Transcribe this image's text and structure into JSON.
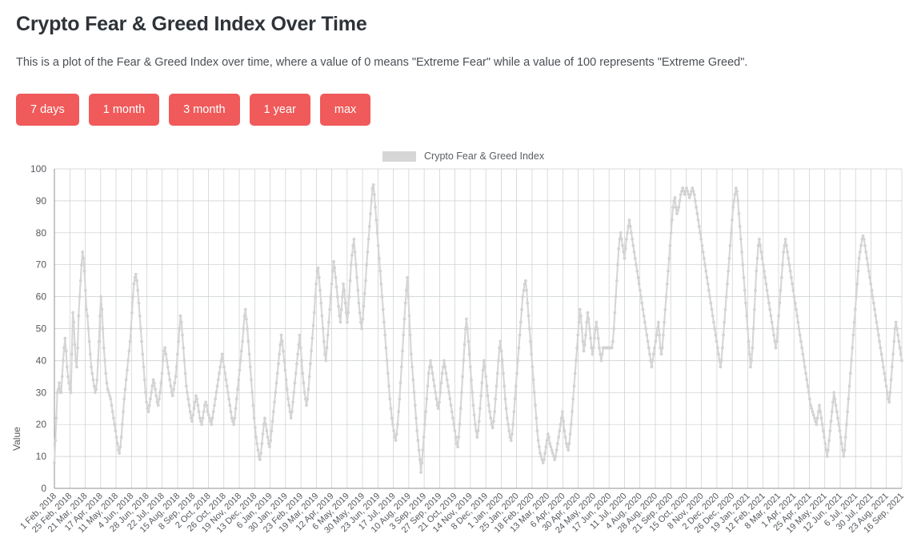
{
  "header": {
    "title": "Crypto Fear & Greed Index Over Time",
    "description": "This is a plot of the Fear & Greed Index over time, where a value of 0 means \"Extreme Fear\" while a value of 100 represents \"Extreme Greed\"."
  },
  "range_buttons": [
    {
      "label": "7 days"
    },
    {
      "label": "1 month"
    },
    {
      "label": "3 month"
    },
    {
      "label": "1 year"
    },
    {
      "label": "max"
    }
  ],
  "colors": {
    "button": "#f05a5a",
    "button_text": "#ffffff",
    "series": "#d3d3d3",
    "grid": "#c9cdd1",
    "axis": "#8c9195",
    "text": "#55595e",
    "title": "#2e3338"
  },
  "chart_data": {
    "type": "line",
    "title": "",
    "xlabel": "",
    "ylabel": "Value",
    "ylim": [
      0,
      100
    ],
    "ytick_step": 10,
    "yticks": [
      0,
      10,
      20,
      30,
      40,
      50,
      60,
      70,
      80,
      90,
      100
    ],
    "grid": true,
    "legend_position": "top-center",
    "legend": [
      "Crypto Fear & Greed Index"
    ],
    "series": [
      {
        "name": "Crypto Fear & Greed Index",
        "color": "#d3d3d3",
        "marker": "circle",
        "values": [
          8,
          15,
          22,
          30,
          31,
          33,
          30,
          30,
          35,
          40,
          44,
          47,
          43,
          38,
          35,
          33,
          31,
          30,
          42,
          55,
          52,
          45,
          40,
          38,
          44,
          54,
          60,
          65,
          70,
          74,
          72,
          68,
          62,
          56,
          54,
          50,
          46,
          42,
          38,
          36,
          34,
          32,
          30,
          31,
          34,
          40,
          46,
          54,
          60,
          56,
          50,
          44,
          40,
          36,
          33,
          31,
          30,
          29,
          28,
          26,
          24,
          22,
          20,
          18,
          16,
          14,
          12,
          11,
          13,
          16,
          20,
          24,
          28,
          31,
          34,
          37,
          40,
          43,
          46,
          50,
          55,
          60,
          64,
          66,
          67,
          65,
          62,
          58,
          54,
          50,
          46,
          42,
          38,
          34,
          30,
          27,
          25,
          24,
          26,
          28,
          30,
          32,
          34,
          33,
          31,
          29,
          27,
          26,
          28,
          30,
          33,
          36,
          40,
          43,
          44,
          42,
          40,
          38,
          36,
          34,
          32,
          30,
          29,
          31,
          33,
          35,
          38,
          42,
          46,
          50,
          54,
          52,
          48,
          44,
          40,
          36,
          32,
          30,
          28,
          26,
          24,
          22,
          21,
          23,
          25,
          27,
          29,
          28,
          26,
          24,
          22,
          21,
          20,
          22,
          24,
          26,
          27,
          26,
          24,
          23,
          22,
          21,
          20,
          22,
          24,
          26,
          28,
          30,
          32,
          34,
          36,
          38,
          40,
          42,
          40,
          38,
          36,
          34,
          32,
          30,
          28,
          26,
          24,
          22,
          21,
          20,
          22,
          25,
          28,
          31,
          34,
          37,
          40,
          43,
          46,
          50,
          54,
          56,
          53,
          50,
          46,
          42,
          38,
          34,
          30,
          26,
          22,
          19,
          16,
          14,
          12,
          10,
          9,
          11,
          14,
          17,
          20,
          22,
          20,
          18,
          16,
          14,
          13,
          15,
          18,
          21,
          24,
          27,
          30,
          33,
          36,
          39,
          42,
          45,
          48,
          46,
          43,
          40,
          37,
          34,
          31,
          28,
          26,
          24,
          22,
          24,
          27,
          30,
          33,
          36,
          39,
          42,
          45,
          48,
          44,
          40,
          36,
          33,
          30,
          28,
          26,
          28,
          31,
          35,
          39,
          43,
          47,
          51,
          55,
          60,
          64,
          68,
          69,
          66,
          62,
          58,
          54,
          50,
          46,
          42,
          40,
          44,
          48,
          52,
          56,
          60,
          64,
          68,
          71,
          69,
          66,
          63,
          60,
          57,
          54,
          52,
          56,
          60,
          64,
          62,
          58,
          55,
          52,
          55,
          60,
          65,
          70,
          73,
          76,
          78,
          74,
          70,
          66,
          62,
          58,
          55,
          52,
          50,
          53,
          57,
          61,
          65,
          70,
          74,
          78,
          82,
          86,
          90,
          94,
          95,
          92,
          88,
          84,
          80,
          76,
          72,
          68,
          64,
          60,
          56,
          52,
          48,
          44,
          40,
          36,
          32,
          28,
          25,
          22,
          20,
          18,
          16,
          15,
          17,
          20,
          24,
          28,
          33,
          38,
          43,
          48,
          53,
          58,
          62,
          66,
          60,
          54,
          48,
          42,
          38,
          34,
          30,
          26,
          22,
          18,
          15,
          12,
          9,
          5,
          8,
          12,
          16,
          20,
          24,
          28,
          32,
          36,
          38,
          40,
          38,
          36,
          34,
          32,
          30,
          28,
          26,
          25,
          27,
          30,
          33,
          36,
          38,
          40,
          38,
          36,
          34,
          32,
          30,
          28,
          26,
          24,
          22,
          20,
          18,
          16,
          14,
          13,
          16,
          20,
          25,
          30,
          35,
          40,
          45,
          50,
          53,
          50,
          46,
          42,
          38,
          34,
          30,
          26,
          23,
          20,
          18,
          16,
          18,
          21,
          25,
          29,
          33,
          37,
          40,
          38,
          35,
          32,
          29,
          26,
          24,
          22,
          20,
          19,
          21,
          24,
          28,
          32,
          36,
          40,
          44,
          46,
          43,
          40,
          36,
          32,
          28,
          25,
          22,
          20,
          18,
          16,
          15,
          17,
          20,
          24,
          28,
          32,
          36,
          40,
          44,
          48,
          52,
          56,
          60,
          62,
          64,
          65,
          62,
          58,
          54,
          50,
          46,
          42,
          38,
          34,
          30,
          26,
          22,
          18,
          15,
          13,
          11,
          10,
          9,
          8,
          9,
          11,
          13,
          15,
          17,
          16,
          14,
          13,
          12,
          11,
          10,
          9,
          10,
          12,
          14,
          16,
          18,
          20,
          22,
          24,
          21,
          18,
          16,
          14,
          13,
          12,
          14,
          17,
          20,
          24,
          28,
          32,
          36,
          40,
          44,
          48,
          52,
          56,
          54,
          50,
          46,
          43,
          45,
          48,
          52,
          55,
          53,
          50,
          47,
          44,
          42,
          44,
          47,
          50,
          52,
          50,
          47,
          44,
          42,
          40,
          42,
          44,
          44,
          44,
          44,
          44,
          44,
          44,
          44,
          44,
          44,
          46,
          50,
          55,
          60,
          65,
          70,
          75,
          78,
          80,
          78,
          76,
          74,
          72,
          75,
          78,
          80,
          82,
          84,
          82,
          80,
          78,
          76,
          74,
          72,
          70,
          68,
          66,
          64,
          62,
          60,
          58,
          56,
          54,
          52,
          50,
          48,
          46,
          44,
          42,
          40,
          38,
          40,
          42,
          44,
          46,
          48,
          50,
          52,
          48,
          44,
          42,
          44,
          48,
          52,
          56,
          60,
          64,
          68,
          72,
          76,
          80,
          84,
          88,
          90,
          91,
          88,
          86,
          87,
          88,
          90,
          92,
          93,
          94,
          93,
          92,
          93,
          94,
          93,
          92,
          91,
          92,
          93,
          94,
          93,
          92,
          90,
          88,
          86,
          84,
          82,
          80,
          78,
          76,
          74,
          72,
          70,
          68,
          66,
          64,
          62,
          60,
          58,
          56,
          54,
          52,
          50,
          48,
          46,
          44,
          42,
          40,
          38,
          40,
          44,
          48,
          52,
          56,
          60,
          64,
          68,
          72,
          76,
          80,
          84,
          88,
          90,
          92,
          94,
          93,
          90,
          86,
          82,
          78,
          74,
          70,
          66,
          62,
          58,
          54,
          50,
          46,
          42,
          38,
          40,
          44,
          50,
          56,
          62,
          68,
          72,
          76,
          78,
          76,
          74,
          72,
          70,
          68,
          66,
          64,
          62,
          60,
          58,
          56,
          54,
          52,
          50,
          48,
          46,
          44,
          46,
          50,
          54,
          58,
          62,
          66,
          70,
          74,
          76,
          78,
          76,
          74,
          72,
          70,
          68,
          66,
          64,
          62,
          60,
          58,
          56,
          54,
          52,
          50,
          48,
          46,
          44,
          42,
          40,
          38,
          36,
          34,
          32,
          30,
          28,
          26,
          25,
          24,
          23,
          22,
          21,
          20,
          22,
          24,
          26,
          24,
          22,
          20,
          18,
          16,
          14,
          12,
          10,
          12,
          15,
          18,
          21,
          24,
          27,
          30,
          28,
          26,
          24,
          22,
          20,
          18,
          16,
          14,
          12,
          10,
          12,
          16,
          20,
          24,
          28,
          32,
          36,
          40,
          44,
          48,
          52,
          56,
          60,
          64,
          68,
          72,
          74,
          76,
          78,
          79,
          78,
          76,
          74,
          72,
          70,
          68,
          66,
          64,
          62,
          60,
          58,
          56,
          54,
          52,
          50,
          48,
          46,
          44,
          42,
          40,
          38,
          36,
          34,
          32,
          30,
          28,
          27,
          30,
          34,
          38,
          42,
          46,
          50,
          52,
          50,
          48,
          46,
          44,
          42,
          40
        ]
      }
    ],
    "xtick_labels": [
      "1 Feb, 2018",
      "25 Feb, 2018",
      "21 Mar, 2018",
      "17 Apr, 2018",
      "11 May, 2018",
      "4 Jun, 2018",
      "28 Jun, 2018",
      "22 Jul, 2018",
      "15 Aug, 2018",
      "8 Sep, 2018",
      "2 Oct, 2018",
      "26 Oct, 2018",
      "19 Nov, 2018",
      "13 Dec, 2018",
      "6 Jan, 2019",
      "30 Jan, 2019",
      "23 Feb, 2019",
      "19 Mar, 2019",
      "12 Apr, 2019",
      "6 May, 2019",
      "30 May, 2019",
      "23 Jun, 2019",
      "17 Jul, 2019",
      "10 Aug, 2019",
      "3 Sep, 2019",
      "27 Sep, 2019",
      "21 Oct, 2019",
      "14 Nov, 2019",
      "8 Dec, 2019",
      "1 Jan, 2020",
      "25 Jan, 2020",
      "18 Feb, 2020",
      "13 Mar, 2020",
      "6 Apr, 2020",
      "30 Apr, 2020",
      "24 May, 2020",
      "17 Jun, 2020",
      "11 Jul, 2020",
      "4 Aug, 2020",
      "28 Aug, 2020",
      "21 Sep, 2020",
      "15 Oct, 2020",
      "8 Nov, 2020",
      "2 Dec, 2020",
      "26 Dec, 2020",
      "19 Jan, 2021",
      "12 Feb, 2021",
      "8 Mar, 2021",
      "1 Apr, 2021",
      "25 Apr, 2021",
      "19 May, 2021",
      "12 Jun, 2021",
      "6 Jul, 2021",
      "30 Jul, 2021",
      "23 Aug, 2021",
      "16 Sep, 2021"
    ]
  }
}
